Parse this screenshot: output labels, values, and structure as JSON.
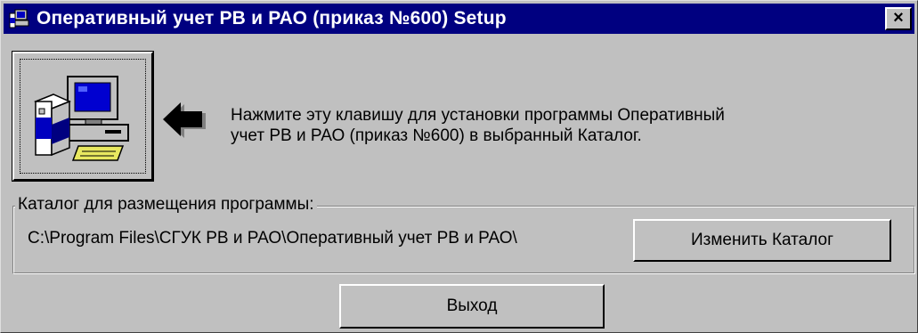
{
  "window": {
    "title": "Оперативный учет РВ и РАО (приказ №600) Setup",
    "close_label": "×"
  },
  "instructions": {
    "line1": "Нажмите эту клавишу для установки программы Оперативный",
    "line2": "учет РВ и РАО (приказ №600) в выбранный Каталог."
  },
  "directory": {
    "legend": "Каталог для размещения программы:",
    "path": "C:\\Program Files\\СГУК РВ и РАО\\Оперативный учет РВ и РАО\\",
    "change_label": "Изменить Каталог"
  },
  "footer": {
    "exit_label": "Выход"
  },
  "icons": {
    "title": "setup-computer-icon",
    "setup_button": "computer-install-icon",
    "pointer": "arrow-left-icon"
  },
  "colors": {
    "face": "#c0c0c0",
    "titlebar": "#000080",
    "title_text": "#ffffff"
  }
}
